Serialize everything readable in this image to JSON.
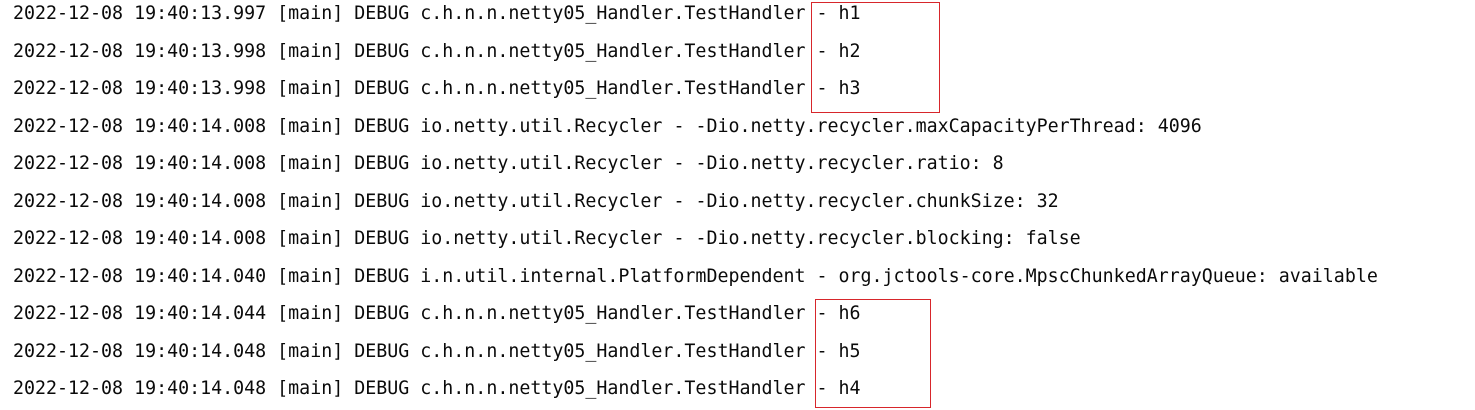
{
  "console": {
    "lines": [
      {
        "timestamp": "2022-12-08 19:40:13.997",
        "thread": "[main]",
        "level": "DEBUG",
        "logger": "c.h.n.n.netty05_Handler.TestHandler",
        "message": "- h1"
      },
      {
        "timestamp": "2022-12-08 19:40:13.998",
        "thread": "[main]",
        "level": "DEBUG",
        "logger": "c.h.n.n.netty05_Handler.TestHandler",
        "message": "- h2"
      },
      {
        "timestamp": "2022-12-08 19:40:13.998",
        "thread": "[main]",
        "level": "DEBUG",
        "logger": "c.h.n.n.netty05_Handler.TestHandler",
        "message": "- h3"
      },
      {
        "timestamp": "2022-12-08 19:40:14.008",
        "thread": "[main]",
        "level": "DEBUG",
        "logger": "io.netty.util.Recycler",
        "message": "- -Dio.netty.recycler.maxCapacityPerThread: 4096"
      },
      {
        "timestamp": "2022-12-08 19:40:14.008",
        "thread": "[main]",
        "level": "DEBUG",
        "logger": "io.netty.util.Recycler",
        "message": "- -Dio.netty.recycler.ratio: 8"
      },
      {
        "timestamp": "2022-12-08 19:40:14.008",
        "thread": "[main]",
        "level": "DEBUG",
        "logger": "io.netty.util.Recycler",
        "message": "- -Dio.netty.recycler.chunkSize: 32"
      },
      {
        "timestamp": "2022-12-08 19:40:14.008",
        "thread": "[main]",
        "level": "DEBUG",
        "logger": "io.netty.util.Recycler",
        "message": "- -Dio.netty.recycler.blocking: false"
      },
      {
        "timestamp": "2022-12-08 19:40:14.040",
        "thread": "[main]",
        "level": "DEBUG",
        "logger": "i.n.util.internal.PlatformDependent",
        "message": "- org.jctools-core.MpscChunkedArrayQueue: available"
      },
      {
        "timestamp": "2022-12-08 19:40:14.044",
        "thread": "[main]",
        "level": "DEBUG",
        "logger": "c.h.n.n.netty05_Handler.TestHandler",
        "message": "- h6"
      },
      {
        "timestamp": "2022-12-08 19:40:14.048",
        "thread": "[main]",
        "level": "DEBUG",
        "logger": "c.h.n.n.netty05_Handler.TestHandler",
        "message": "- h5"
      },
      {
        "timestamp": "2022-12-08 19:40:14.048",
        "thread": "[main]",
        "level": "DEBUG",
        "logger": "c.h.n.n.netty05_Handler.TestHandler",
        "message": "- h4"
      }
    ]
  },
  "colors": {
    "text": "#0a0a0a",
    "background": "#ffffff",
    "highlight": "#d7262b"
  }
}
